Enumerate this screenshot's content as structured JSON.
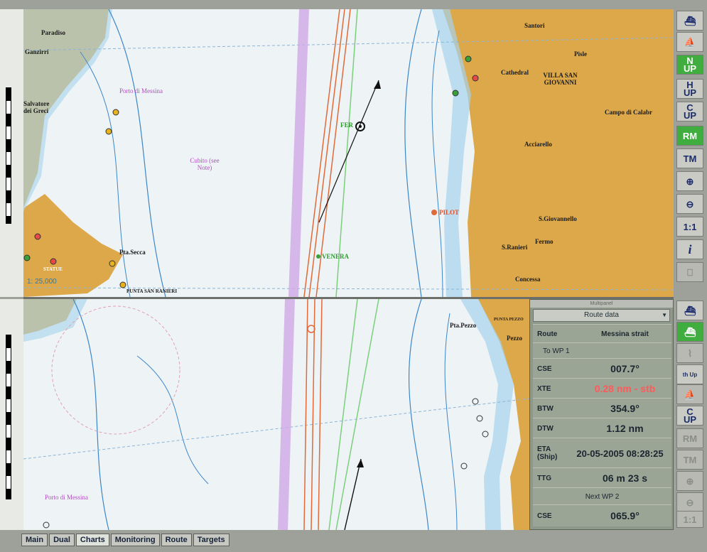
{
  "top_map": {
    "place_names": [
      "Paradiso",
      "Ganzirri",
      "Porto di Messina",
      "Salvatore dei Greci",
      "Pta.Secca",
      "STATUE",
      "PUNTA SAN RANIERI",
      "Santori",
      "Pisle",
      "Cathedral",
      "VILLA SAN GIOVANNI",
      "Campo di Calabr",
      "Acciarello",
      "S.Giovannello",
      "S.Ranieri",
      "Fermo",
      "Concessa",
      "Cubito (see Note)"
    ],
    "nav_labels": {
      "fer": "FER",
      "pilot": "PILOT",
      "venera": "VENERA"
    },
    "scale": "1: 25,000"
  },
  "bottom_map": {
    "place_names": [
      "Pta.Pezzo",
      "PUNTA PEZZO",
      "Pezzo",
      "Porto di Messina"
    ]
  },
  "toolbar_top": [
    "ship",
    "ship-up",
    "N UP",
    "H UP",
    "C UP",
    "RM",
    "TM",
    "zoom-in",
    "zoom-out",
    "1:1",
    "i"
  ],
  "toolbar_bottom": [
    "ship",
    "ship-green",
    "route",
    "th Up",
    "ship-up",
    "C UP",
    "RM",
    "TM",
    "zoom-in",
    "zoom-out",
    "1:1"
  ],
  "route_panel": {
    "titlebar": "Multipanel",
    "dropdown": "Route data",
    "route_label": "Route",
    "route_value": "Messina strait",
    "to_wp": "To WP 1",
    "rows": [
      {
        "label": "CSE",
        "value": "007.7°"
      },
      {
        "label": "XTE",
        "value": "0.28 nm - stb"
      },
      {
        "label": "BTW",
        "value": "354.9°"
      },
      {
        "label": "DTW",
        "value": "1.12 nm"
      },
      {
        "label": "ETA (Ship)",
        "value": "20-05-2005 08:28:25"
      },
      {
        "label": "TTG",
        "value": "06 m 23 s"
      }
    ],
    "next_wp": "Next WP 2",
    "next_cse_label": "CSE",
    "next_cse_value": "065.9°"
  },
  "tabs": [
    "Main",
    "Dual",
    "Charts",
    "Monitoring",
    "Route",
    "Targets"
  ]
}
